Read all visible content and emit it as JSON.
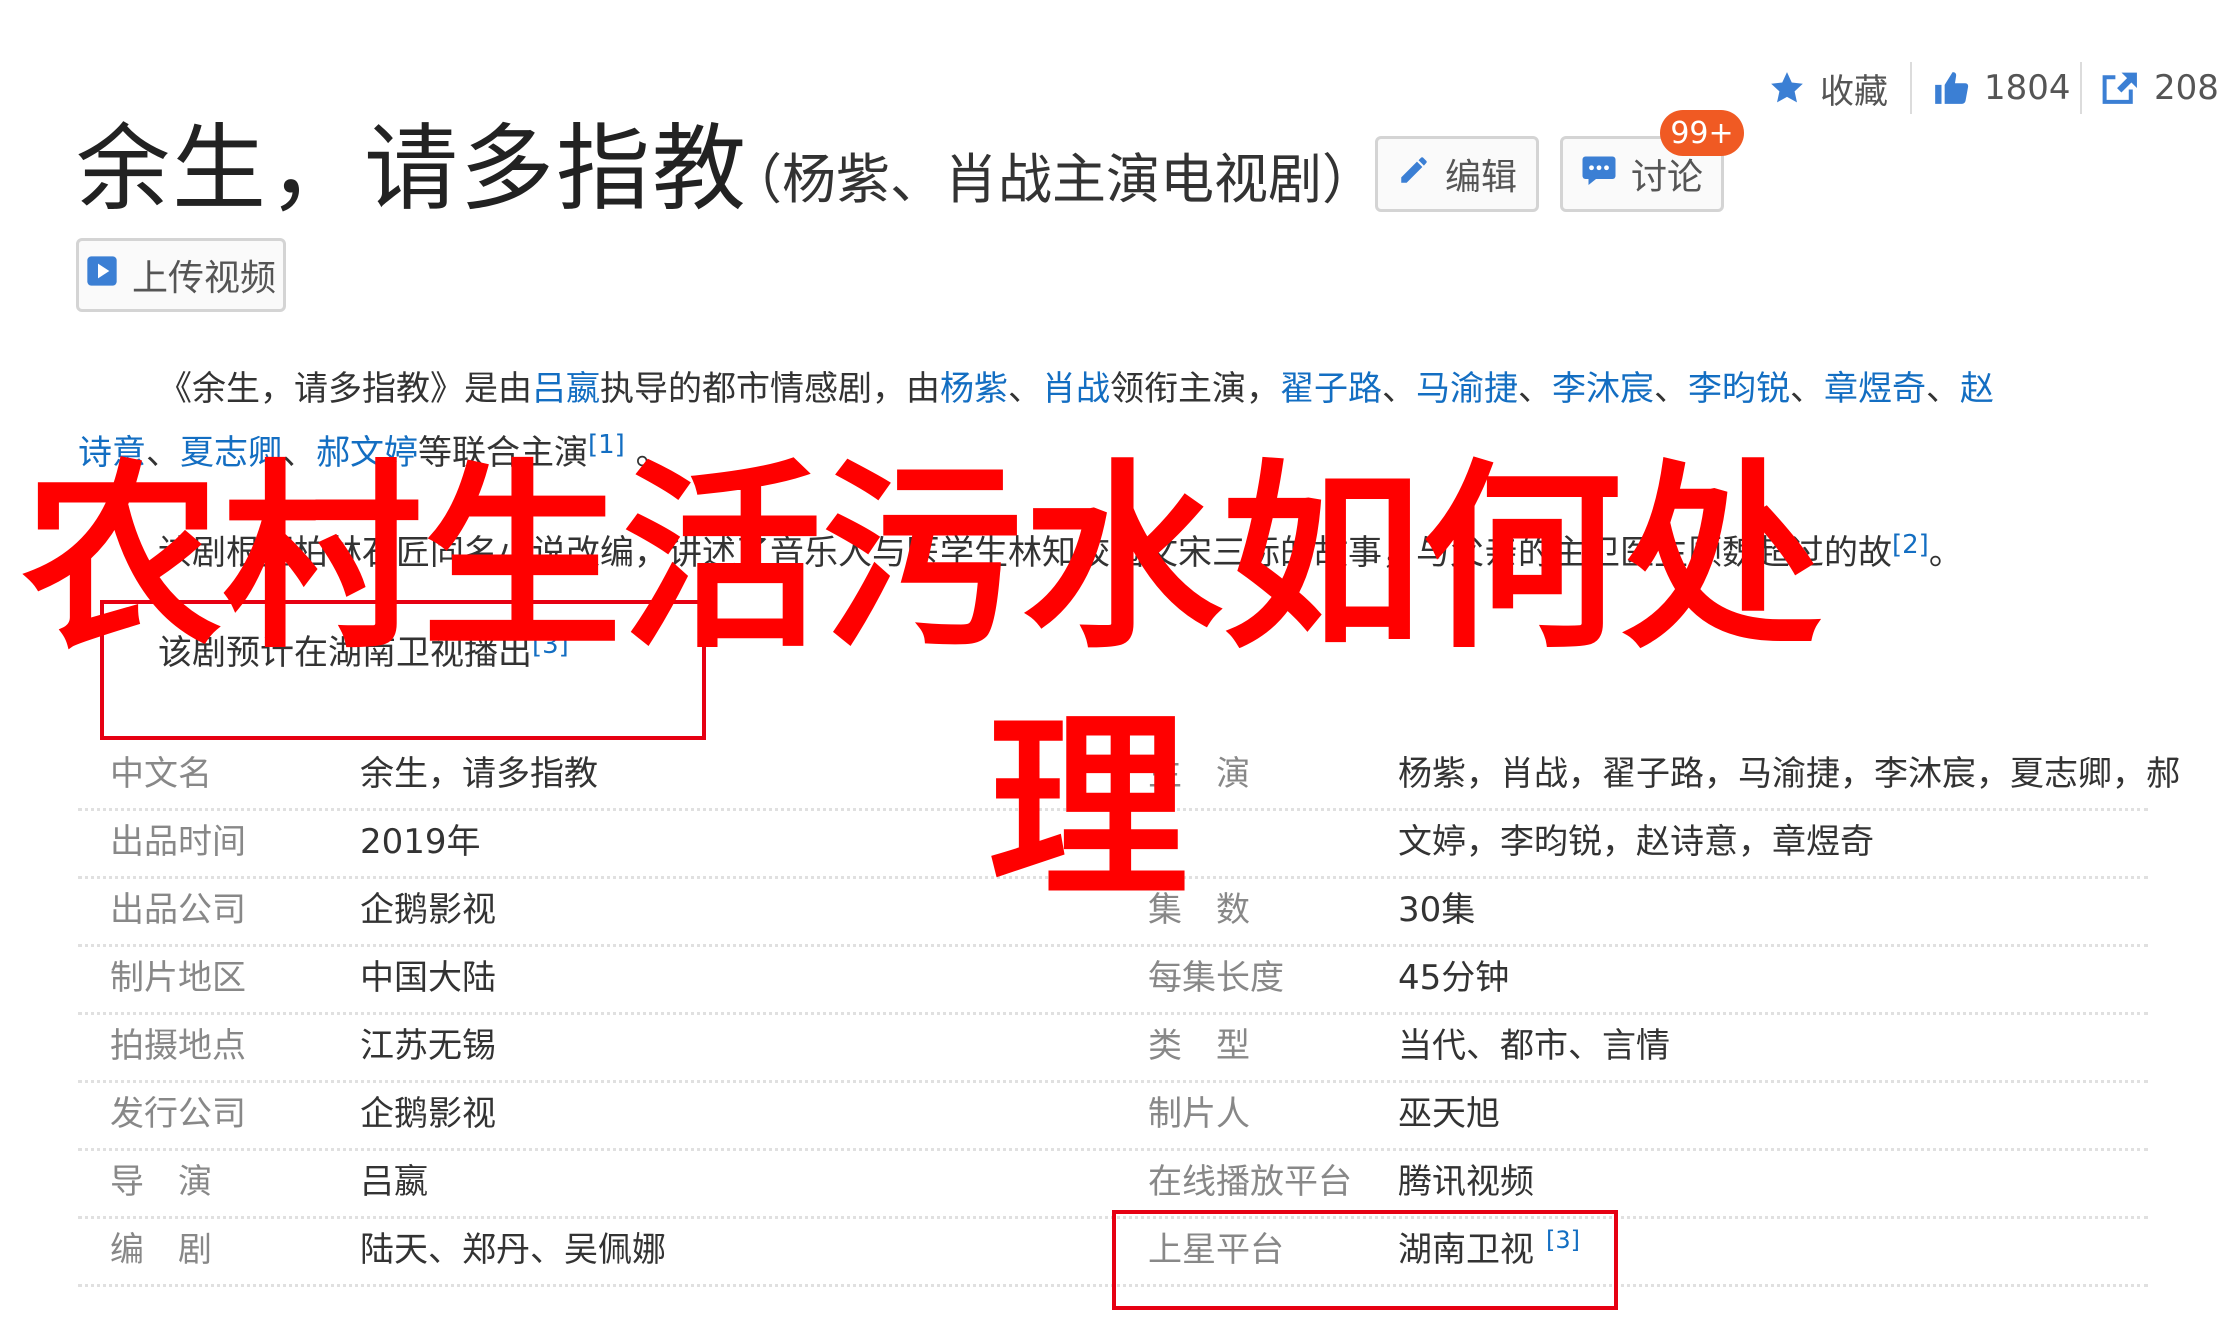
{
  "stats": {
    "favorite_label": "收藏",
    "like_count": "1804",
    "share_count": "208"
  },
  "title": {
    "main": "余生，请多指教",
    "subtitle": "（杨紫、肖战主演电视剧）"
  },
  "buttons": {
    "edit": "编辑",
    "discuss": "讨论",
    "discuss_badge": "99+",
    "upload_video": "上传视频"
  },
  "summary": {
    "p1": {
      "pre": "《余生，请多指教》是由",
      "director": "吕嬴",
      "mid1": "执导的都市情感剧，由",
      "actor1": "杨紫",
      "sep1": "、",
      "actor2": "肖战",
      "mid2": "领衔主演，",
      "actor3": "翟子路",
      "sep2": "、",
      "actor4": "马渝捷",
      "sep3": "、",
      "actor5": "李沐宸",
      "sep4": "、",
      "actor6": "李昀锐",
      "sep5": "、",
      "actor7": "章煜奇",
      "sep6": "、",
      "actor8a": "赵",
      "actor8b": "诗意",
      "sep7": "、",
      "actor9": "夏志卿",
      "sep8": "、",
      "actor10": "郝文婷",
      "post": "等联合主演",
      "ref": "[1]",
      "end": "。"
    },
    "p2": {
      "text": "该剧根据柏林石匠同名小说改编，讲述了音乐人与医学生林知校园文宋三标的故事，与父亲的主卫医生顾魏超过的故",
      "ref": "[2]",
      "end": "。"
    },
    "p3": {
      "text": "该剧预计在湖南卫视播出",
      "ref": "[3]"
    }
  },
  "infobox": {
    "left": [
      {
        "label": "中文名",
        "value": "余生，请多指教"
      },
      {
        "label": "出品时间",
        "value": "2019年"
      },
      {
        "label": "出品公司",
        "value": "企鹅影视"
      },
      {
        "label": "制片地区",
        "value": "中国大陆"
      },
      {
        "label": "拍摄地点",
        "value": "江苏无锡"
      },
      {
        "label": "发行公司",
        "value": "企鹅影视"
      },
      {
        "label": "导　演",
        "value": "吕嬴"
      },
      {
        "label": "编　剧",
        "value": "陆天、郑丹、吴佩娜"
      }
    ],
    "right": [
      {
        "label": "主　演",
        "value": "杨紫，肖战，翟子路，马渝捷，李沐宸，夏志卿，郝"
      },
      {
        "label": "",
        "value": "文婷，李昀锐，赵诗意，章煜奇"
      },
      {
        "label": "集　数",
        "value": "30集"
      },
      {
        "label": "每集长度",
        "value": "45分钟"
      },
      {
        "label": "类　型",
        "value": "当代、都市、言情"
      },
      {
        "label": "制片人",
        "value": "巫天旭"
      },
      {
        "label": "在线播放平台",
        "value": "腾讯视频"
      },
      {
        "label": "上星平台",
        "value": "湖南卫视",
        "ref": "[3]"
      }
    ]
  },
  "overlay": {
    "line1": "农村生活污水如何处",
    "line2": "理"
  },
  "colors": {
    "link": "#136ec2",
    "overlay": "#ff0000",
    "annotation_box": "#e60012",
    "badge": "#f05a23"
  }
}
